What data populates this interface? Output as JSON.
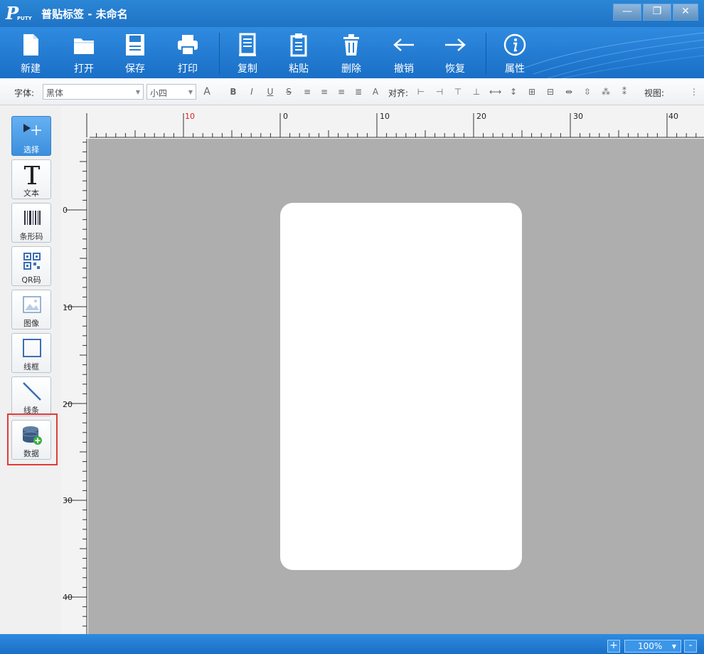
{
  "window": {
    "logo_text": "P",
    "logo_small": "PUTY",
    "title": "普贴标签 - 未命名",
    "minimize": "—",
    "restore": "❐",
    "close": "✕"
  },
  "toolbar": {
    "items": [
      {
        "label": "新建",
        "icon": "new-file-icon"
      },
      {
        "label": "打开",
        "icon": "folder-icon"
      },
      {
        "label": "保存",
        "icon": "save-icon"
      },
      {
        "label": "打印",
        "icon": "printer-icon"
      },
      {
        "label": "复制",
        "icon": "copy-icon"
      },
      {
        "label": "粘贴",
        "icon": "paste-icon"
      },
      {
        "label": "删除",
        "icon": "trash-icon"
      },
      {
        "label": "撤销",
        "icon": "undo-arrow-icon"
      },
      {
        "label": "恢复",
        "icon": "redo-arrow-icon"
      },
      {
        "label": "属性",
        "icon": "info-icon"
      }
    ]
  },
  "formatbar": {
    "font_label": "字体:",
    "font_value": "黑体",
    "size_value": "小四",
    "grow_font": "A",
    "bold": "B",
    "italic": "I",
    "underline": "U",
    "strike": "S",
    "font_color": "A",
    "align_label": "对齐:",
    "view_label": "视图:"
  },
  "palette": {
    "items": [
      {
        "label": "选择",
        "icon": "select-pointer-icon"
      },
      {
        "label": "文本",
        "icon": "text-icon"
      },
      {
        "label": "条形码",
        "icon": "barcode-icon"
      },
      {
        "label": "QR码",
        "icon": "qrcode-icon"
      },
      {
        "label": "图像",
        "icon": "image-icon"
      },
      {
        "label": "线框",
        "icon": "rectangle-icon"
      },
      {
        "label": "线条",
        "icon": "line-icon"
      },
      {
        "label": "数据",
        "icon": "database-icon"
      }
    ]
  },
  "rulers": {
    "h_labels": [
      "10",
      "0",
      "10",
      "20",
      "30",
      "40"
    ],
    "v_labels": [
      "0",
      "10",
      "20",
      "30",
      "40"
    ]
  },
  "statusbar": {
    "zoom_in": "+",
    "zoom_value": "100%",
    "zoom_out": "-"
  },
  "colors": {
    "accent": "#1f73c4",
    "active_tool": "#3b8fdd",
    "highlight": "#e23a3a",
    "canvas": "#aeaeae",
    "ruler_red": "#e02020"
  }
}
